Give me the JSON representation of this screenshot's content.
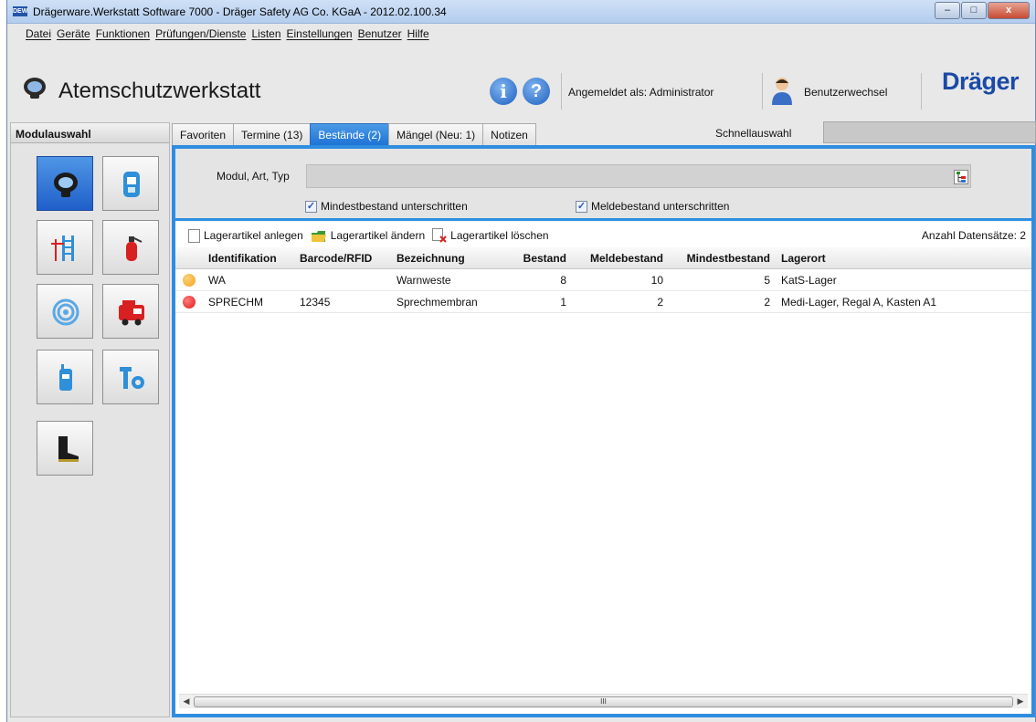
{
  "window": {
    "title": "Drägerware.Werkstatt Software 7000 - Dräger Safety AG  Co. KGaA - 2012.02.100.34",
    "app_icon": "DEW",
    "buttons": {
      "minimize": "–",
      "maximize": "□",
      "close": "x"
    }
  },
  "menu": [
    "Datei",
    "Geräte",
    "Funktionen",
    "Prüfungen/Dienste",
    "Listen",
    "Einstellungen",
    "Benutzer",
    "Hilfe"
  ],
  "header": {
    "title": "Atemschutzwerkstatt",
    "info_icon": "i",
    "help_icon": "?",
    "logged_in": "Angemeldet als: Administrator",
    "switch_user": "Benutzerwechsel",
    "brand": "Dräger"
  },
  "sidebar": {
    "title": "Modulauswahl",
    "modules": [
      "mask-icon",
      "device-icon",
      "ladder-icon",
      "extinguisher-icon",
      "hose-icon",
      "vehicle-icon",
      "radio-icon",
      "tools-icon",
      "boot-icon"
    ]
  },
  "tabs": [
    {
      "label": "Favoriten",
      "active": false
    },
    {
      "label": "Termine (13)",
      "active": false
    },
    {
      "label": "Bestände (2)",
      "active": true
    },
    {
      "label": "Mängel (Neu: 1)",
      "active": false
    },
    {
      "label": "Notizen",
      "active": false
    }
  ],
  "quickselect": {
    "label": "Schnellauswahl",
    "value": ""
  },
  "filter": {
    "label": "Modul, Art, Typ",
    "value": "",
    "check1": {
      "label": "Mindestbestand unterschritten",
      "checked": true
    },
    "check2": {
      "label": "Meldebestand unterschritten",
      "checked": true
    }
  },
  "toolbar": {
    "create": "Lagerartikel anlegen",
    "edit": "Lagerartikel ändern",
    "delete": "Lagerartikel löschen",
    "count": "Anzahl Datensätze: 2"
  },
  "table": {
    "columns": [
      "Identifikation",
      "Barcode/RFID",
      "Bezeichnung",
      "Bestand",
      "Meldebestand",
      "Mindestbestand",
      "Lagerort"
    ],
    "rows": [
      {
        "status_color": "#f2a21c",
        "id": "WA",
        "barcode": "",
        "name": "Warnweste",
        "stock": "8",
        "report": "10",
        "min": "5",
        "location": "KatS-Lager"
      },
      {
        "status_color": "#e01a1a",
        "id": "SPRECHM",
        "barcode": "12345",
        "name": "Sprechmembran",
        "stock": "1",
        "report": "2",
        "min": "2",
        "location": "Medi-Lager, Regal A, Kasten A1"
      }
    ]
  },
  "scrollbar": {
    "grip": "III"
  }
}
